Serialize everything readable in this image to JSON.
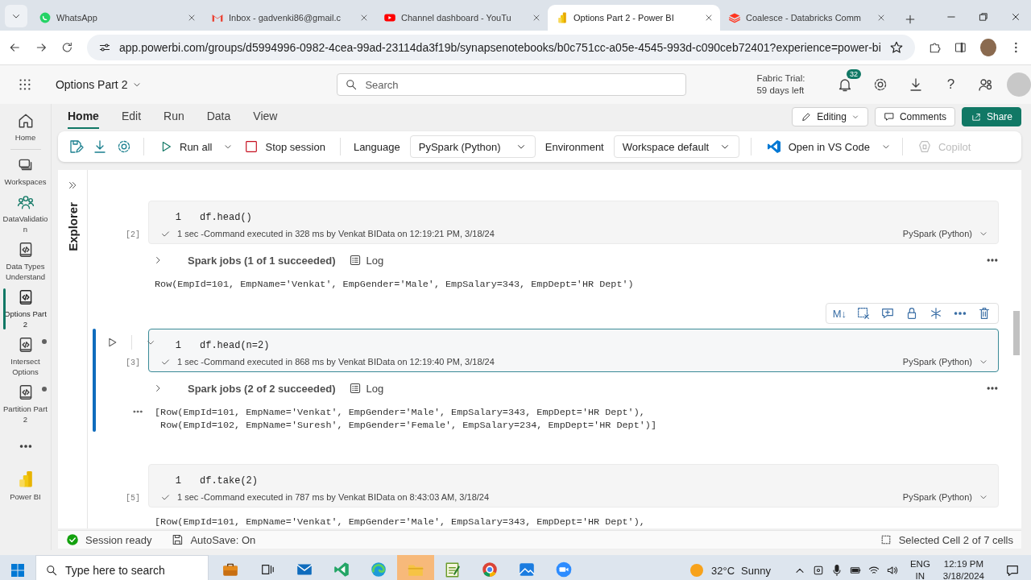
{
  "browser": {
    "tabs": [
      {
        "title": "WhatsApp",
        "selected": false
      },
      {
        "title": "Inbox - gadvenki86@gmail.c",
        "selected": false
      },
      {
        "title": "Channel dashboard - YouTu",
        "selected": false
      },
      {
        "title": "Options Part 2 - Power BI",
        "selected": true
      },
      {
        "title": "Coalesce - Databricks Comm",
        "selected": false
      }
    ],
    "url": "app.powerbi.com/groups/d5994996-0982-4cea-99ad-23114da3f19b/synapsenotebooks/b0c751cc-a05e-4545-993d-c090ceb72401?experience=power-bi"
  },
  "app": {
    "title": "Options Part 2",
    "search_placeholder": "Search",
    "trial": [
      "Fabric Trial:",
      "59 days left"
    ],
    "notifications": "32",
    "help": "?"
  },
  "rail": [
    {
      "label": "Home",
      "selected": false,
      "unsaved": false
    },
    {
      "label": "Workspaces",
      "selected": false,
      "unsaved": false
    },
    {
      "label": "DataValidation",
      "selected": false,
      "unsaved": false
    },
    {
      "label": "Data Types Understand",
      "selected": false,
      "unsaved": false
    },
    {
      "label": "Options Part 2",
      "selected": true,
      "unsaved": false
    },
    {
      "label": "Intersect Options",
      "selected": false,
      "unsaved": true
    },
    {
      "label": "Partition Part 2",
      "selected": false,
      "unsaved": true
    },
    {
      "label": "Power BI",
      "selected": false,
      "unsaved": false
    }
  ],
  "ribbon": {
    "tabs": [
      {
        "label": "Home",
        "selected": true
      },
      {
        "label": "Edit",
        "selected": false
      },
      {
        "label": "Run",
        "selected": false
      },
      {
        "label": "Data",
        "selected": false
      },
      {
        "label": "View",
        "selected": false
      }
    ],
    "actions": [
      {
        "label": "Editing",
        "kind": "menu"
      },
      {
        "label": "Comments",
        "kind": "plain"
      },
      {
        "label": "Share",
        "kind": "primary"
      }
    ]
  },
  "toolbar": {
    "run_all": "Run all",
    "stop_session": "Stop session",
    "language_label": "Language",
    "language": "PySpark (Python)",
    "environment_label": "Environment",
    "environment": "Workspace default",
    "vscode": "Open in VS Code",
    "copilot": {
      "label": "Copilot",
      "disabled": true
    }
  },
  "explorer": "Explorer",
  "cell_toolbar": {
    "markdown": "M↓"
  },
  "cells": [
    {
      "line": "1",
      "code": "df.head()",
      "count": "[2]",
      "status": "1 sec -Command executed in 328 ms by Venkat BIData on 12:19:21 PM, 3/18/24",
      "language": "PySpark (Python)",
      "selected": false,
      "jobs": "Spark jobs (1 of 1 succeeded)",
      "log": "Log",
      "output": [
        "Row(EmpId=101, EmpName='Venkat', EmpGender='Male', EmpSalary=343, EmpDept='HR Dept')"
      ]
    },
    {
      "line": "1",
      "code": "df.head(n=2)",
      "count": "[3]",
      "status": "1 sec -Command executed in 868 ms by Venkat BIData on 12:19:40 PM, 3/18/24",
      "language": "PySpark (Python)",
      "selected": true,
      "jobs": "Spark jobs (2 of 2 succeeded)",
      "log": "Log",
      "output": [
        "[Row(EmpId=101, EmpName='Venkat', EmpGender='Male', EmpSalary=343, EmpDept='HR Dept'),",
        " Row(EmpId=102, EmpName='Suresh', EmpGender='Female', EmpSalary=234, EmpDept='HR Dept')]"
      ]
    },
    {
      "line": "1",
      "code": "df.take(2)",
      "count": "[5]",
      "status": "1 sec -Command executed in 787 ms by Venkat BIData on 8:43:03 AM, 3/18/24",
      "language": "PySpark (Python)",
      "selected": false,
      "output": [
        "[Row(EmpId=101, EmpName='Venkat', EmpGender='Male', EmpSalary=343, EmpDept='HR Dept'),"
      ]
    }
  ],
  "status_bar": {
    "session": "Session ready",
    "autosave": "AutoSave: On",
    "selection": "Selected Cell 2 of 7 cells"
  },
  "taskbar": {
    "search_placeholder": "Type here to search",
    "temperature": "32°C",
    "weather": "Sunny",
    "lang": [
      "ENG",
      "IN"
    ],
    "time": "12:19 PM",
    "date": "3/18/2024"
  }
}
